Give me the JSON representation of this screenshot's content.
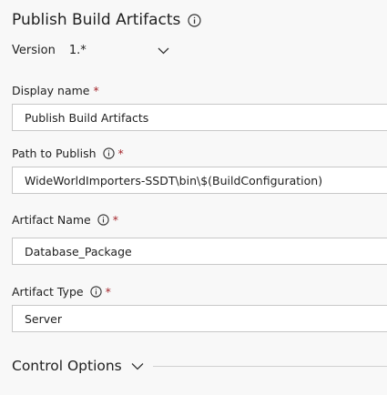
{
  "task": {
    "title": "Publish Build Artifacts",
    "title_icon": "info-icon"
  },
  "version": {
    "label": "Version",
    "value": "1.*",
    "dropdown_icon": "chevron-down-icon"
  },
  "fields": {
    "display_name": {
      "label": "Display name",
      "required_marker": "*",
      "value": "Publish Build Artifacts"
    },
    "path_to_publish": {
      "label": "Path to Publish",
      "required_marker": "*",
      "info_icon": "info-icon",
      "value": "WideWorldImporters-SSDT\\bin\\$(BuildConfiguration)"
    },
    "artifact_name": {
      "label": "Artifact Name",
      "required_marker": "*",
      "info_icon": "info-icon",
      "value": "Database_Package"
    },
    "artifact_type": {
      "label": "Artifact Type",
      "required_marker": "*",
      "info_icon": "info-icon",
      "value": "Server"
    }
  },
  "control_options": {
    "label": "Control Options",
    "chevron_icon": "chevron-down-icon"
  },
  "colors": {
    "background": "#f8f8f8",
    "text": "#212121",
    "required": "#a4262c",
    "input_border": "#c8c8c8",
    "input_background": "#ffffff"
  }
}
